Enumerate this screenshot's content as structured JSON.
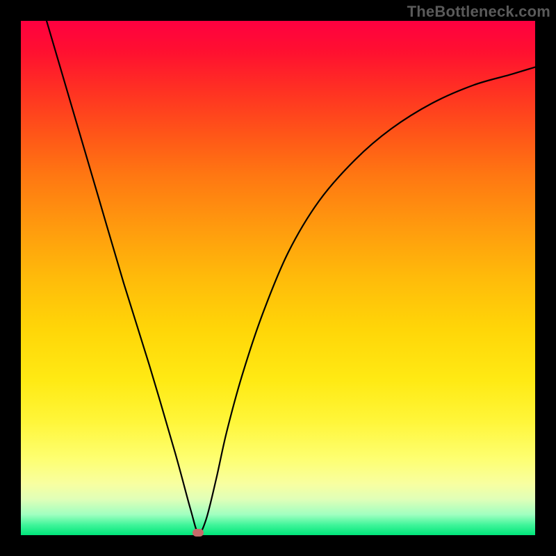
{
  "watermark": "TheBottleneck.com",
  "chart_data": {
    "type": "line",
    "title": "",
    "xlabel": "",
    "ylabel": "",
    "xlim": [
      0,
      100
    ],
    "ylim": [
      0,
      100
    ],
    "series": [
      {
        "name": "curve",
        "x": [
          5,
          10,
          15,
          20,
          25,
          30,
          33,
          34.5,
          36,
          38,
          40,
          43,
          47,
          52,
          58,
          65,
          72,
          80,
          88,
          95,
          100
        ],
        "values": [
          100,
          83,
          66,
          49,
          33,
          16,
          5,
          0.5,
          3,
          11,
          20,
          31,
          43,
          55,
          65,
          73,
          79,
          84,
          87.5,
          89.5,
          91
        ]
      }
    ],
    "gradient_stops": [
      {
        "pos": 0,
        "color": "#ff0040"
      },
      {
        "pos": 50,
        "color": "#ffbb0a"
      },
      {
        "pos": 85,
        "color": "#feff70"
      },
      {
        "pos": 100,
        "color": "#00e57a"
      }
    ],
    "marker": {
      "x": 34.5,
      "y": 0.5,
      "color": "#c76a6a"
    }
  }
}
